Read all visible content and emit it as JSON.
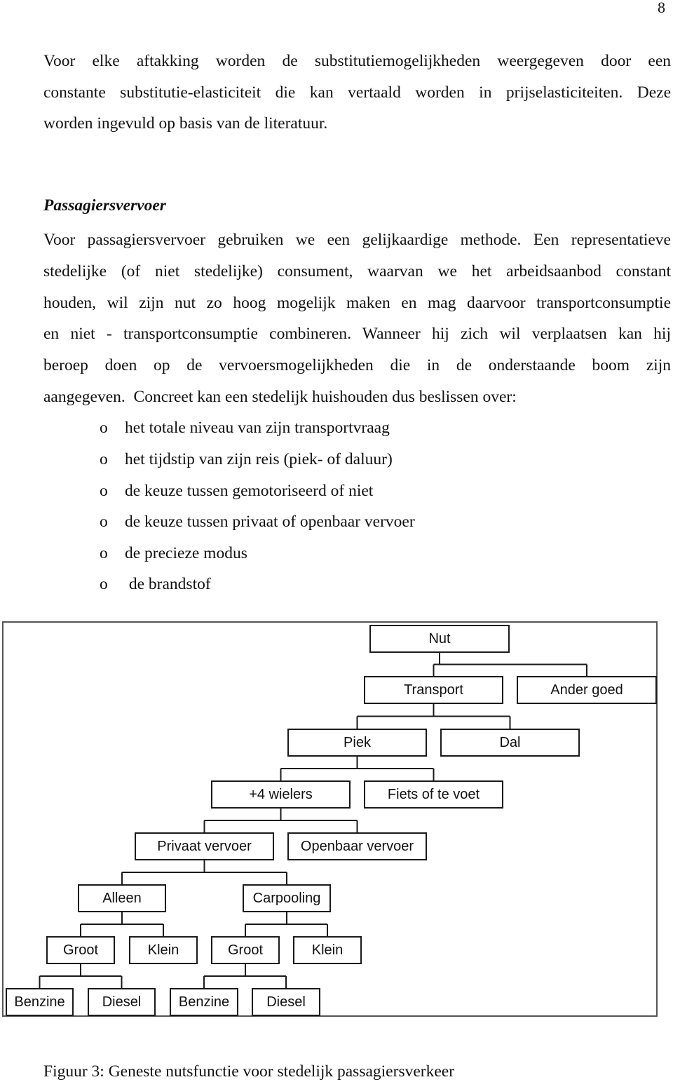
{
  "page_number": "8",
  "intro_paragraph": {
    "lines": [
      "Voor elke aftakking worden de substitutiemogelijkheden weergegeven door een",
      "constante substitutie-elasticiteit die kan vertaald worden in prijselasticiteiten. Deze",
      "worden ingevuld op basis van de literatuur."
    ]
  },
  "section": {
    "heading": "Passagiersvervoer",
    "paragraph_lines": [
      "Voor passagiersvervoer gebruiken we een gelijkaardige methode. Een representatieve",
      "stedelijke (of niet stedelijke) consument, waarvan we het arbeidsaanbod constant",
      "houden, wil zijn nut zo hoog mogelijk maken en mag daarvoor transportconsumptie",
      "en niet - transportconsumptie combineren. Wanneer hij zich wil verplaatsen kan hij",
      "beroep doen op de vervoersmogelijkheden die in de onderstaande boom zijn",
      "aangegeven.  Concreet kan een stedelijk huishouden dus beslissen over:"
    ],
    "bullet_marker": "o",
    "bullets": [
      "het totale niveau van zijn transportvraag",
      "het tijdstip van zijn reis (piek- of daluur)",
      "de keuze tussen gemotoriseerd of niet",
      "de keuze tussen privaat of openbaar vervoer",
      "de precieze modus",
      " de brandstof"
    ]
  },
  "diagram": {
    "nodes": {
      "nut": "Nut",
      "transport": "Transport",
      "ander_goed": "Ander goed",
      "piek": "Piek",
      "dal": "Dal",
      "vier_wielers": "+4 wielers",
      "fiets": "Fiets of te voet",
      "privaat": "Privaat vervoer",
      "openbaar": "Openbaar vervoer",
      "alleen": "Alleen",
      "carpooling": "Carpooling",
      "alleen_groot": "Groot",
      "alleen_klein": "Klein",
      "carpool_groot": "Groot",
      "carpool_klein": "Klein",
      "alleen_groot_benzine": "Benzine",
      "alleen_groot_diesel": "Diesel",
      "carpool_groot_benzine": "Benzine",
      "carpool_groot_diesel": "Diesel"
    },
    "edges": [
      [
        "nut",
        "transport"
      ],
      [
        "nut",
        "ander_goed"
      ],
      [
        "transport",
        "piek"
      ],
      [
        "transport",
        "dal"
      ],
      [
        "piek",
        "vier_wielers"
      ],
      [
        "piek",
        "fiets"
      ],
      [
        "vier_wielers",
        "privaat"
      ],
      [
        "vier_wielers",
        "openbaar"
      ],
      [
        "privaat",
        "alleen"
      ],
      [
        "privaat",
        "carpooling"
      ],
      [
        "alleen",
        "alleen_groot"
      ],
      [
        "alleen",
        "alleen_klein"
      ],
      [
        "carpooling",
        "carpool_groot"
      ],
      [
        "carpooling",
        "carpool_klein"
      ],
      [
        "alleen_groot",
        "alleen_groot_benzine"
      ],
      [
        "alleen_groot",
        "alleen_groot_diesel"
      ],
      [
        "carpool_groot",
        "carpool_groot_benzine"
      ],
      [
        "carpool_groot",
        "carpool_groot_diesel"
      ]
    ]
  },
  "caption": "Figuur 3: Geneste nutsfunctie voor stedelijk passagiersverkeer"
}
